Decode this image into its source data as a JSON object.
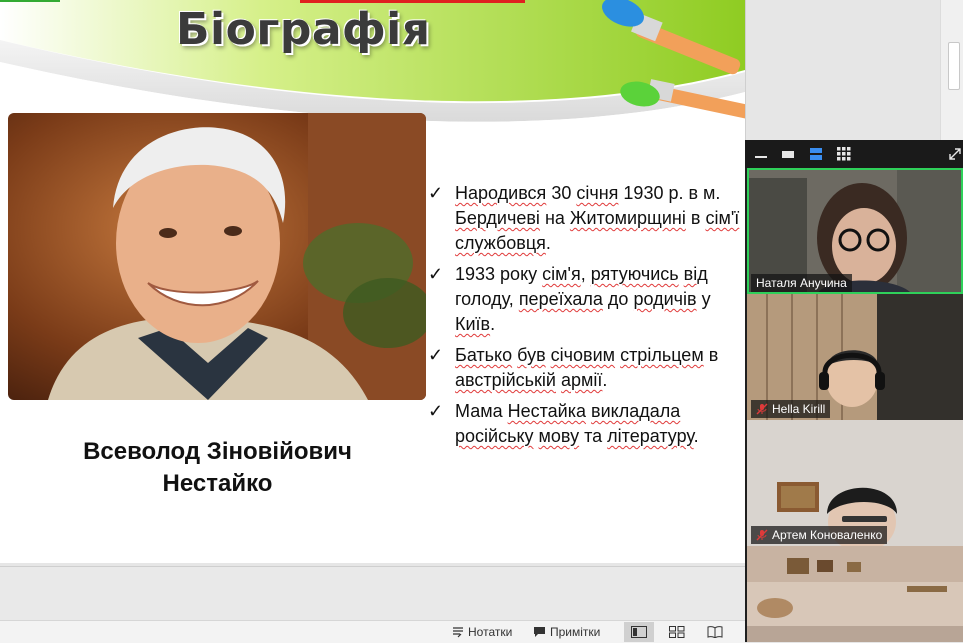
{
  "slide": {
    "title": "Біографія",
    "person_name_line1": "Всеволод Зіновійович",
    "person_name_line2": "Нестайко",
    "bullets": [
      {
        "parts": [
          {
            "text": "Народився",
            "spell": true
          },
          {
            "text": " 30 ",
            "spell": false
          },
          {
            "text": "січня",
            "spell": true
          },
          {
            "text": " 1930 р. в  м. ",
            "spell": false
          },
          {
            "text": "Бердичеві",
            "spell": true
          },
          {
            "text": " на ",
            "spell": false
          },
          {
            "text": "Житомирщині",
            "spell": true
          },
          {
            "text": " в ",
            "spell": false
          },
          {
            "text": "сім'ї",
            "spell": true
          },
          {
            "text": " ",
            "spell": false
          },
          {
            "text": "службовця",
            "spell": true
          },
          {
            "text": ".",
            "spell": false
          }
        ]
      },
      {
        "parts": [
          {
            "text": "1933 року  ",
            "spell": false
          },
          {
            "text": "сім'я",
            "spell": true
          },
          {
            "text": ", ",
            "spell": false
          },
          {
            "text": "рятуючись",
            "spell": true
          },
          {
            "text": " ",
            "spell": false
          },
          {
            "text": "від",
            "spell": true
          },
          {
            "text": " голоду, ",
            "spell": false
          },
          {
            "text": "переїхала",
            "spell": true
          },
          {
            "text": " до ",
            "spell": false
          },
          {
            "text": "родичів",
            "spell": true
          },
          {
            "text": " у ",
            "spell": false
          },
          {
            "text": "Київ",
            "spell": true
          },
          {
            "text": ".",
            "spell": false
          }
        ]
      },
      {
        "parts": [
          {
            "text": "Батько",
            "spell": true
          },
          {
            "text": " ",
            "spell": false
          },
          {
            "text": "був",
            "spell": true
          },
          {
            "text": " ",
            "spell": false
          },
          {
            "text": "січовим",
            "spell": true
          },
          {
            "text": " ",
            "spell": false
          },
          {
            "text": "стрільцем",
            "spell": true
          },
          {
            "text": " в ",
            "spell": false
          },
          {
            "text": "австрійській",
            "spell": true
          },
          {
            "text": " ",
            "spell": false
          },
          {
            "text": "армії",
            "spell": true
          },
          {
            "text": ".",
            "spell": false
          }
        ]
      },
      {
        "parts": [
          {
            "text": "Мама ",
            "spell": false
          },
          {
            "text": "Нестайка",
            "spell": true
          },
          {
            "text": " ",
            "spell": false
          },
          {
            "text": "викладала",
            "spell": true
          },
          {
            "text": " ",
            "spell": false
          },
          {
            "text": "російську",
            "spell": true
          },
          {
            "text": " ",
            "spell": false
          },
          {
            "text": "мову",
            "spell": true
          },
          {
            "text": " та ",
            "spell": false
          },
          {
            "text": "літературу",
            "spell": true
          },
          {
            "text": ".",
            "spell": false
          }
        ]
      }
    ]
  },
  "status_bar": {
    "notes_label": "Нотатки",
    "comments_label": "Примітки",
    "view_buttons": [
      "normal-view",
      "slide-sorter-view",
      "reading-view"
    ],
    "active_view": "normal-view"
  },
  "meeting": {
    "toolbar_icons": [
      "minimize-icon",
      "thumbnail-view-icon",
      "speaker-view-icon",
      "gallery-view-icon",
      "expand-icon"
    ],
    "participants": [
      {
        "name": "Наталя Анучина",
        "muted": false,
        "speaking": true
      },
      {
        "name": "Hella Kirill",
        "muted": true,
        "speaking": false
      },
      {
        "name": "Артем Коноваленко",
        "muted": true,
        "speaking": false
      },
      {
        "name": "",
        "muted": false,
        "speaking": false
      }
    ]
  },
  "colors": {
    "accent_green": "#2fd05a",
    "muted_red": "#e03a3a",
    "slide_green": "#9ed935"
  }
}
